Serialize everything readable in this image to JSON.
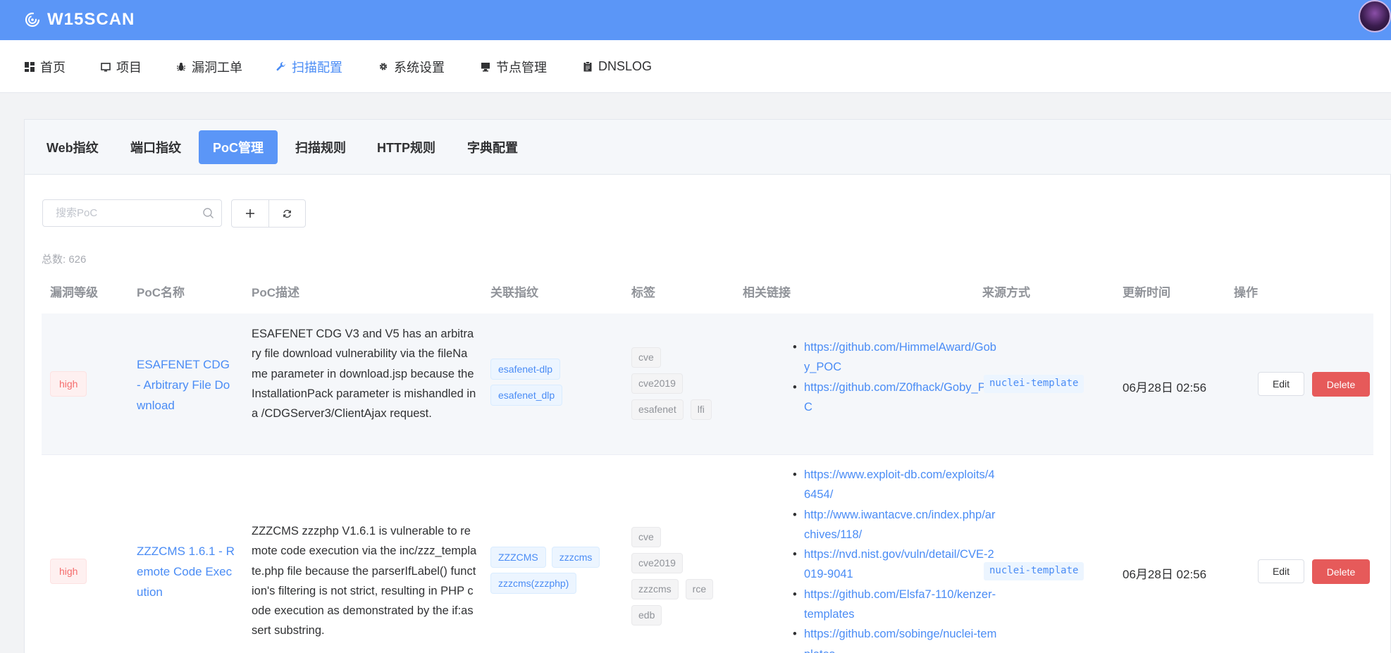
{
  "app": {
    "title": "W15SCAN"
  },
  "nav": {
    "items": [
      {
        "label": "首页",
        "icon": "dashboard-icon"
      },
      {
        "label": "项目",
        "icon": "monitor-icon"
      },
      {
        "label": "漏洞工单",
        "icon": "bug-icon"
      },
      {
        "label": "扫描配置",
        "icon": "wrench-icon",
        "active": true
      },
      {
        "label": "系统设置",
        "icon": "gear-icon"
      },
      {
        "label": "节点管理",
        "icon": "computer-icon"
      },
      {
        "label": "DNSLOG",
        "icon": "clipboard-icon"
      }
    ]
  },
  "tabs": [
    {
      "label": "Web指纹"
    },
    {
      "label": "端口指纹"
    },
    {
      "label": "PoC管理",
      "active": true
    },
    {
      "label": "扫描规则"
    },
    {
      "label": "HTTP规则"
    },
    {
      "label": "字典配置"
    }
  ],
  "search": {
    "placeholder": "搜索PoC",
    "value": ""
  },
  "toolbar": {
    "add_icon": "plus-icon",
    "refresh_icon": "refresh-icon"
  },
  "total": "总数: 626",
  "table": {
    "headers": [
      "漏洞等级",
      "PoC名称",
      "PoC描述",
      "关联指纹",
      "标签",
      "相关链接",
      "来源方式",
      "更新时间",
      "操作"
    ],
    "rows": [
      {
        "level": "high",
        "name": "ESAFENET CDG - Arbitrary File Download",
        "description": "ESAFENET CDG V3 and V5 has an arbitrary file download vulnerability via the fileName parameter in download.jsp because the InstallationPack parameter is mishandled in a /CDGServer3/ClientAjax request.",
        "fingerprints": [
          "esafenet-dlp",
          "esafenet_dlp"
        ],
        "tags": [
          "cve",
          "cve2019",
          "esafenet",
          "lfi"
        ],
        "links": [
          "https://github.com/HimmelAward/Goby_POC",
          "https://github.com/Z0fhack/Goby_POC"
        ],
        "source": "nuclei-template",
        "updated": "06月28日 02:56",
        "edit_label": "Edit",
        "delete_label": "Delete"
      },
      {
        "level": "high",
        "name": "ZZZCMS 1.6.1 - Remote Code Execution",
        "description": "ZZZCMS zzzphp V1.6.1 is vulnerable to remote code execution via the inc/zzz_template.php file because the parserIfLabel() function's filtering is not strict, resulting in PHP code execution as demonstrated by the if:assert substring.",
        "fingerprints": [
          "ZZZCMS",
          "zzzcms",
          "zzzcms(zzzphp)"
        ],
        "tags": [
          "cve",
          "cve2019",
          "zzzcms",
          "rce",
          "edb"
        ],
        "links": [
          "https://www.exploit-db.com/exploits/46454/",
          "http://www.iwantacve.cn/index.php/archives/118/",
          "https://nvd.nist.gov/vuln/detail/CVE-2019-9041",
          "https://github.com/Elsfa7-110/kenzer-templates",
          "https://github.com/sobinge/nuclei-templates"
        ],
        "source": "nuclei-template",
        "updated": "06月28日 02:56",
        "edit_label": "Edit",
        "delete_label": "Delete"
      }
    ]
  },
  "colors": {
    "primary": "#5b96f7",
    "link": "#4a8cf5",
    "danger": "#e65a5a",
    "high_tag": "#f56c6c"
  }
}
